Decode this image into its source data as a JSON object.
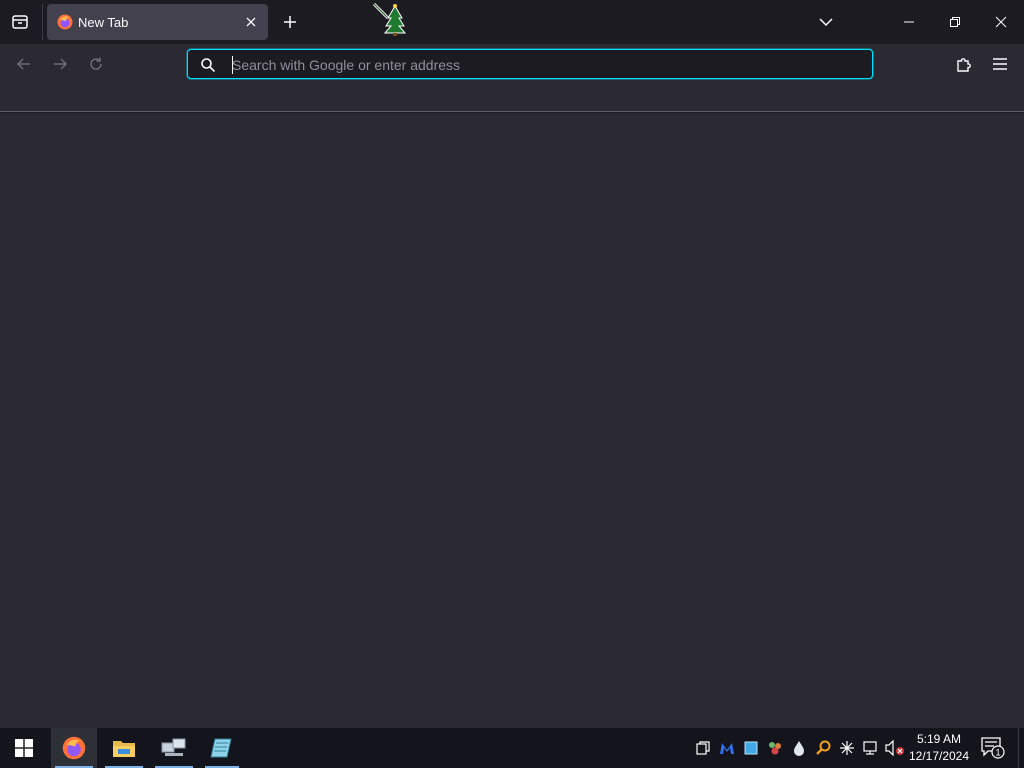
{
  "browser": {
    "tab": {
      "title": "New Tab",
      "active": true
    },
    "urlbar": {
      "placeholder": "Search with Google or enter address",
      "value": ""
    }
  },
  "taskbar": {
    "pinned": [
      "start-button",
      "firefox",
      "file-explorer",
      "network-app",
      "notepad-app"
    ],
    "tray_icons": [
      "window-icon",
      "malwarebytes-icon",
      "blue-square-icon",
      "people-icon",
      "water-drop-icon",
      "search-tool-icon",
      "asterisk-icon",
      "network-icon",
      "volume-muted-icon"
    ],
    "clock": {
      "time": "5:19 AM",
      "date": "12/17/2024"
    },
    "notifications": {
      "count": "1"
    }
  },
  "colors": {
    "accent": "#00ddff",
    "tab_active": "#42414d",
    "toolbar": "#2b2a33",
    "frame": "#1c1b22",
    "taskbar": "#14151c"
  }
}
